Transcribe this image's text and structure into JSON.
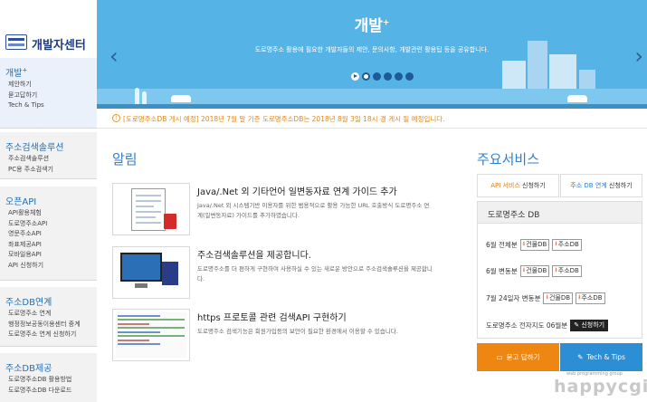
{
  "brand": {
    "title": "개발자센터"
  },
  "sidebar": {
    "sections": [
      {
        "title": "개발",
        "title_sup": "+",
        "items": [
          "제안하기",
          "묻고답하기",
          "Tech & Tips"
        ]
      },
      {
        "title": "주소검색솔루션",
        "items": [
          "주소검색솔루션",
          "PC용 주소검색기"
        ]
      },
      {
        "title": "오픈API",
        "items": [
          "API활용체험",
          "도로명주소API",
          "영문주소API",
          "좌표제공API",
          "모바일용API",
          "API 신청하기"
        ]
      },
      {
        "title": "주소DB연계",
        "items": [
          "도로명주소 연계",
          "행정정보공동이용센터 중계",
          "도로명주소 연계 신청하기"
        ]
      },
      {
        "title": "주소DB제공",
        "items": [
          "도로명주소DB 활용방법",
          "도로명주소DB 다운로드"
        ]
      }
    ]
  },
  "hero": {
    "title": "개발",
    "title_sup": "+",
    "description": "도로명주소 활용에 필요한 개발자들의 제안, 문의사항, 개발관련 활용팁 등을 공유합니다.",
    "prev": "‹",
    "next": "›"
  },
  "notice": {
    "icon": "!",
    "text": "[도로명주소DB 게시 예정] 2018년 7월 말 기준 도로명주소DB는 2018년 8월 3일 18시 경 게시 될 예정입니다."
  },
  "news": {
    "title": "알림",
    "items": [
      {
        "title": "Java/.Net 외 기타언어 일변동자료 연계 가이드 추가",
        "desc": "Java/.Net 외 시스템기반 이용자를 위한 범용적으로 활용 가능한 URL 호출방식 도로명주소 연계(일변동자료) 가이드를 추가하였습니다."
      },
      {
        "title": "주소검색솔루션을 제공합니다.",
        "desc": "도로명주소를 더 편하게 구현하여 사용하실 수 있는 새로운 방안으로 주소검색솔루션을 제공합니다."
      },
      {
        "title": "https 프로토콜 관련 검색API 구현하기",
        "desc": "도로명주소 검색기능은 회원가입등의 보안이 필요한 환경에서 이용할 수 있습니다."
      }
    ]
  },
  "services": {
    "title": "주요서비스",
    "api_btn": {
      "highlight": "API 서비스",
      "rest": " 신청하기"
    },
    "db_btn": {
      "highlight": "주소 DB 연계",
      "rest": " 신청하기"
    },
    "db_panel": {
      "title": "도로명주소 DB",
      "rows": [
        {
          "label": "6월 전체분",
          "buttons": [
            "건물DB",
            "주소DB"
          ]
        },
        {
          "label": "6월 변동분",
          "buttons": [
            "건물DB",
            "주소DB"
          ]
        },
        {
          "label": "7월 24일자 변동분",
          "buttons": [
            "건물DB",
            "주소DB"
          ]
        }
      ],
      "map_label": "도로명주소 전자지도 06월분",
      "apply": "신청하기"
    },
    "cta_qa": "묻고 답하기",
    "cta_tech": "Tech & Tips"
  },
  "watermark": {
    "small": "web programming group",
    "big": "happycgi"
  }
}
